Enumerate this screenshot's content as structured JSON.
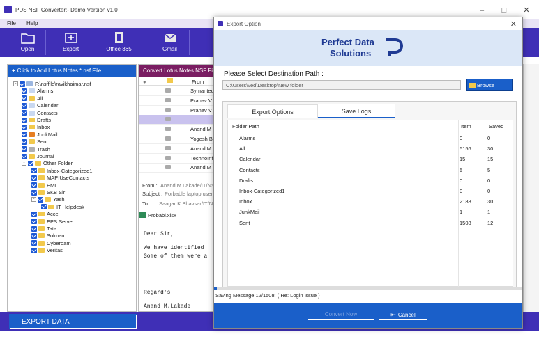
{
  "app": {
    "title": "PDS NSF Converter:- Demo Version v1.0",
    "menu": [
      "File",
      "Help"
    ],
    "ribbon": [
      "Open",
      "Export",
      "Office 365",
      "Gmail"
    ]
  },
  "left_panel": {
    "header": "Click to Add Lotus Notes *.nsf File",
    "tree": [
      {
        "label": "F:\\nsffile\\ravikhaimar.nsf",
        "level": 0,
        "icon": "file"
      },
      {
        "label": "Alarms",
        "level": 1,
        "icon": "alarm"
      },
      {
        "label": "All",
        "level": 1,
        "icon": "folder"
      },
      {
        "label": "Calendar",
        "level": 1,
        "icon": "calendar"
      },
      {
        "label": "Contacts",
        "level": 1,
        "icon": "contacts"
      },
      {
        "label": "Drafts",
        "level": 1,
        "icon": "folder"
      },
      {
        "label": "Inbox",
        "level": 1,
        "icon": "folder"
      },
      {
        "label": "JunkMail",
        "level": 1,
        "icon": "junk"
      },
      {
        "label": "Sent",
        "level": 1,
        "icon": "folder"
      },
      {
        "label": "Trash",
        "level": 1,
        "icon": "trash"
      },
      {
        "label": "Journal",
        "level": 1,
        "icon": "folder"
      },
      {
        "label": "Other Folder",
        "level": 1,
        "icon": "folder"
      },
      {
        "label": "Inbox-Categorized1",
        "level": 2,
        "icon": "folder"
      },
      {
        "label": "MAPIUseContacts",
        "level": 2,
        "icon": "folder"
      },
      {
        "label": "EML",
        "level": 2,
        "icon": "folder"
      },
      {
        "label": "SKB Sir",
        "level": 2,
        "icon": "folder"
      },
      {
        "label": "Yash",
        "level": 2,
        "icon": "folder"
      },
      {
        "label": "IT Helpdesk",
        "level": 3,
        "icon": "folder"
      },
      {
        "label": "Accel",
        "level": 2,
        "icon": "folder"
      },
      {
        "label": "EPS Server",
        "level": 2,
        "icon": "folder"
      },
      {
        "label": "Tata",
        "level": 2,
        "icon": "folder"
      },
      {
        "label": "Solman",
        "level": 2,
        "icon": "folder"
      },
      {
        "label": "Cyberoam",
        "level": 2,
        "icon": "folder"
      },
      {
        "label": "Veritas",
        "level": 2,
        "icon": "folder"
      }
    ],
    "export_button": "EXPORT DATA"
  },
  "mid_panel": {
    "header": "Convert Lotus Notes NSF File t",
    "column_from": "From",
    "rows": [
      "Symantec,",
      "Pranav V I",
      "Pranav V I",
      "",
      "Anand M L",
      "Yogesh B",
      "Anand M L",
      "TechnoInfo",
      "Anand M L"
    ],
    "from_label": "From :",
    "from_value": "Anand M Lakade/IT/NS",
    "subject_label": "Subject :",
    "subject_value": "Porbable laptop users",
    "to_label": "To :",
    "to_value": "Saagar K Bhavsar/IT/NS",
    "attachment": "Probabl.xlsx",
    "body": [
      "Dear Sir,",
      "We have identified",
      "Some of them were a",
      "Regard's",
      "Anand M.Lakade"
    ]
  },
  "dialog": {
    "title": "Export Option",
    "logo_line1": "Perfect Data",
    "logo_line2": "Solutions",
    "dest_label": "Please Select Destination Path :",
    "dest_path": "C:\\Users\\ved\\Desktop\\New folder",
    "browse": "Browse",
    "tabs": [
      "Export Options",
      "Save Logs"
    ],
    "table": {
      "headers": [
        "Folder Path",
        "Item",
        "Saved"
      ],
      "rows": [
        [
          "Alarms",
          "0",
          "0"
        ],
        [
          "All",
          "5156",
          "30"
        ],
        [
          "Calendar",
          "15",
          "15"
        ],
        [
          "Contacts",
          "5",
          "5"
        ],
        [
          "Drafts",
          "0",
          "0"
        ],
        [
          "Inbox-Categorized1",
          "0",
          "0"
        ],
        [
          "Inbox",
          "2188",
          "30"
        ],
        [
          "JunkMail",
          "1",
          "1"
        ],
        [
          "Sent",
          "1508",
          "12"
        ]
      ]
    },
    "progress": 0.01,
    "status": "Saving Message 12/1508: ( Re: Login issue )",
    "convert_button": "Convert Now",
    "cancel_button": "Cancel"
  }
}
